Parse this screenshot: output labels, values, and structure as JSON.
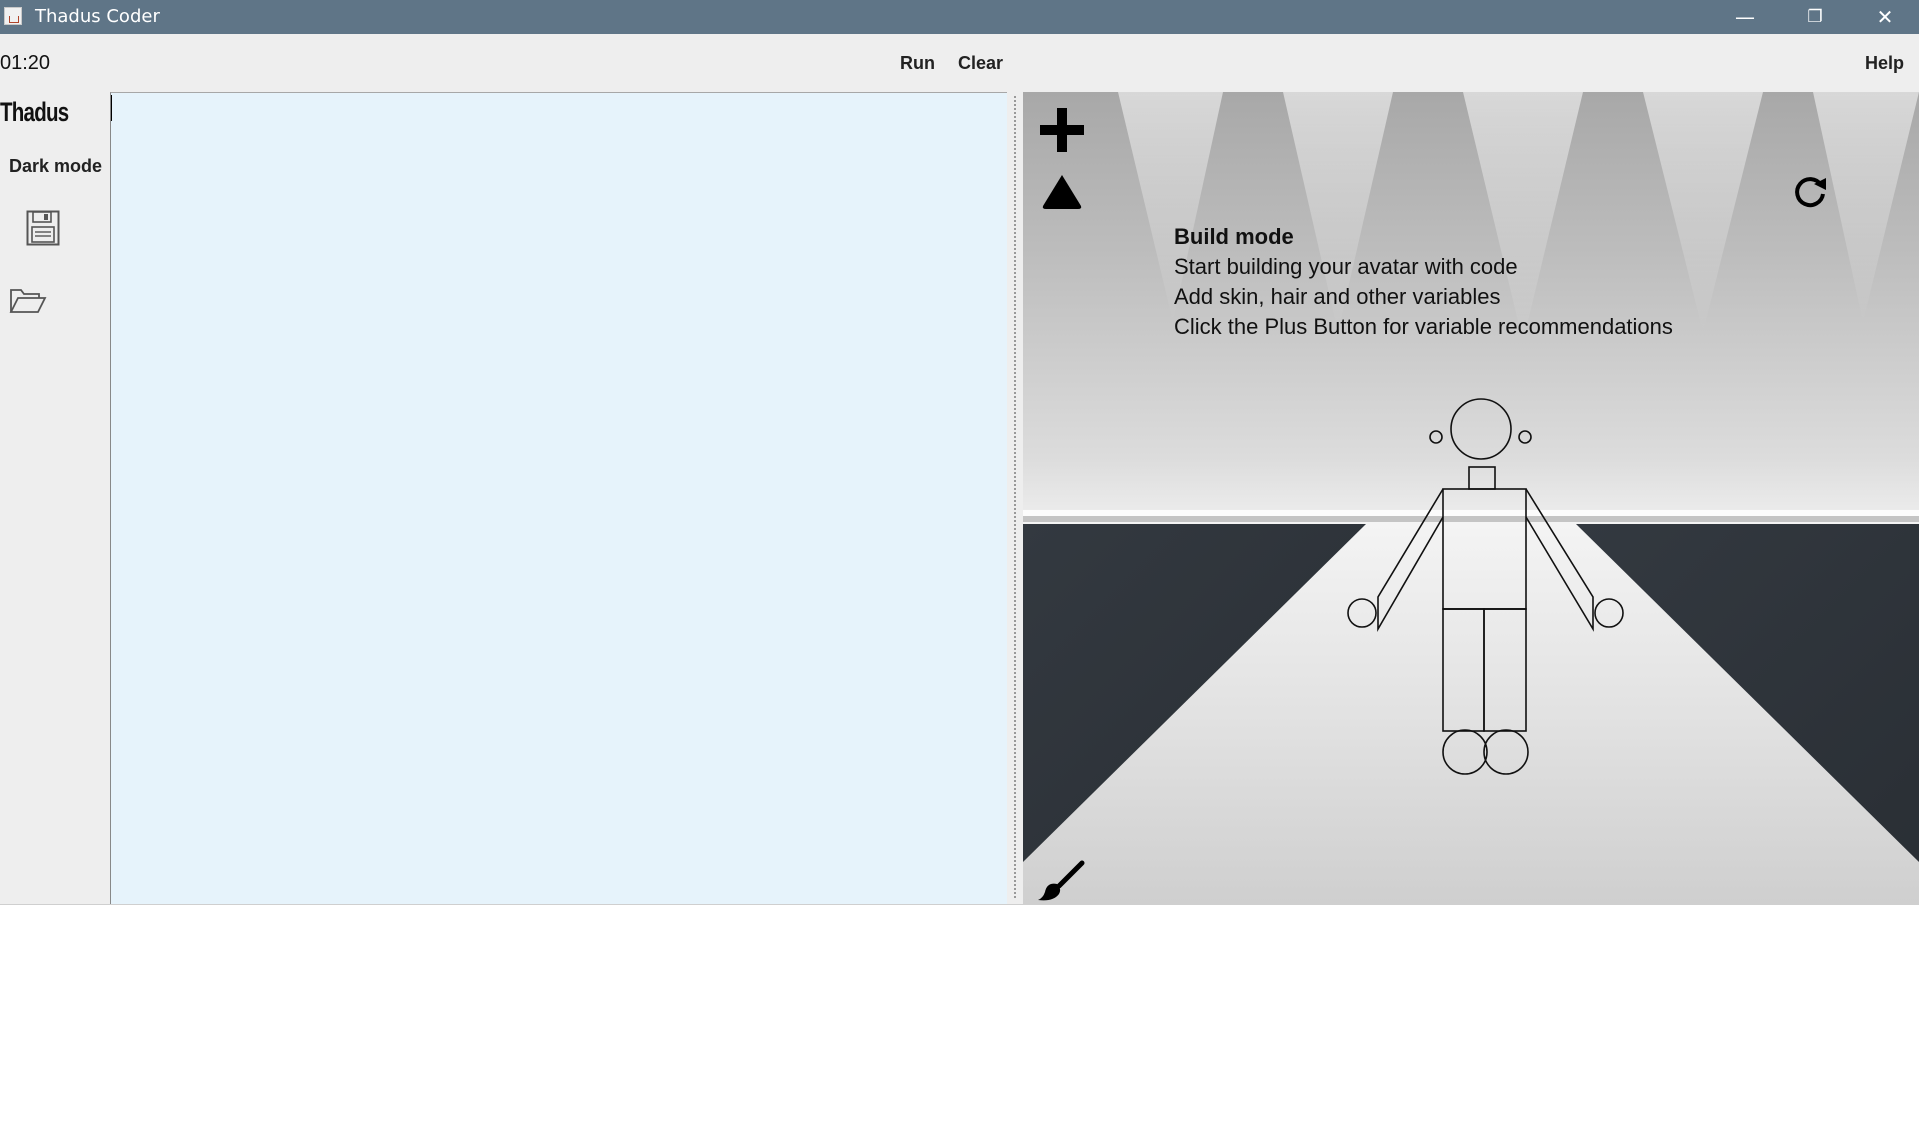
{
  "window": {
    "title": "Thadus Coder",
    "controls": {
      "minimize": "—",
      "maximize": "❐",
      "close": "✕"
    }
  },
  "toolbar": {
    "clock": "01:20",
    "run_label": "Run",
    "clear_label": "Clear",
    "help_label": "Help"
  },
  "sidebar": {
    "logo": "Thadus",
    "dark_mode_label": "Dark mode",
    "save_icon": "floppy-disk-icon",
    "open_icon": "folder-open-icon"
  },
  "editor": {
    "value": ""
  },
  "stage": {
    "title": "Build mode",
    "lines": [
      "Start building your avatar with code",
      "Add skin, hair and other variables",
      "Click the Plus Button for variable recommendations"
    ],
    "icons": [
      "plus-icon",
      "triangle-icon",
      "refresh-icon",
      "paintbrush-icon"
    ]
  },
  "console": {
    "value": ""
  }
}
